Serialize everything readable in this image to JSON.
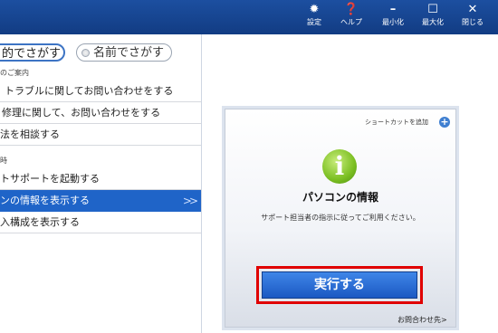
{
  "window_controls": [
    {
      "label": "設定",
      "icon": "gear-icon"
    },
    {
      "label": "ヘルプ",
      "icon": "help-icon"
    },
    {
      "label": "最小化",
      "icon": "minimize-icon"
    },
    {
      "label": "最大化",
      "icon": "maximize-icon"
    },
    {
      "label": "閉じる",
      "icon": "close-icon"
    }
  ],
  "search_modes": {
    "by_purpose": "的でさがす",
    "by_name": "名前でさがす"
  },
  "groups": {
    "group1": "のご案内",
    "group2": "時"
  },
  "items": [
    "トラブルに関してお問い合わせをする",
    "修理に関して、お問い合わせをする",
    "法を相談する",
    "トサポートを起動する",
    "ンの情報を表示する",
    "入構成を表示する"
  ],
  "selected_item_chevron": ">>",
  "card": {
    "shortcut_label": "ショートカットを追加",
    "title": "パソコンの情報",
    "description": "サポート担当者の指示に従ってご利用ください。",
    "run_button": "実行する",
    "contact_link": "お問合わせ先>"
  },
  "colors": {
    "topbar": "#1c4fa0",
    "selection": "#1f64c8",
    "highlight_frame": "#e00000",
    "run_button": "#2a6fd6"
  }
}
